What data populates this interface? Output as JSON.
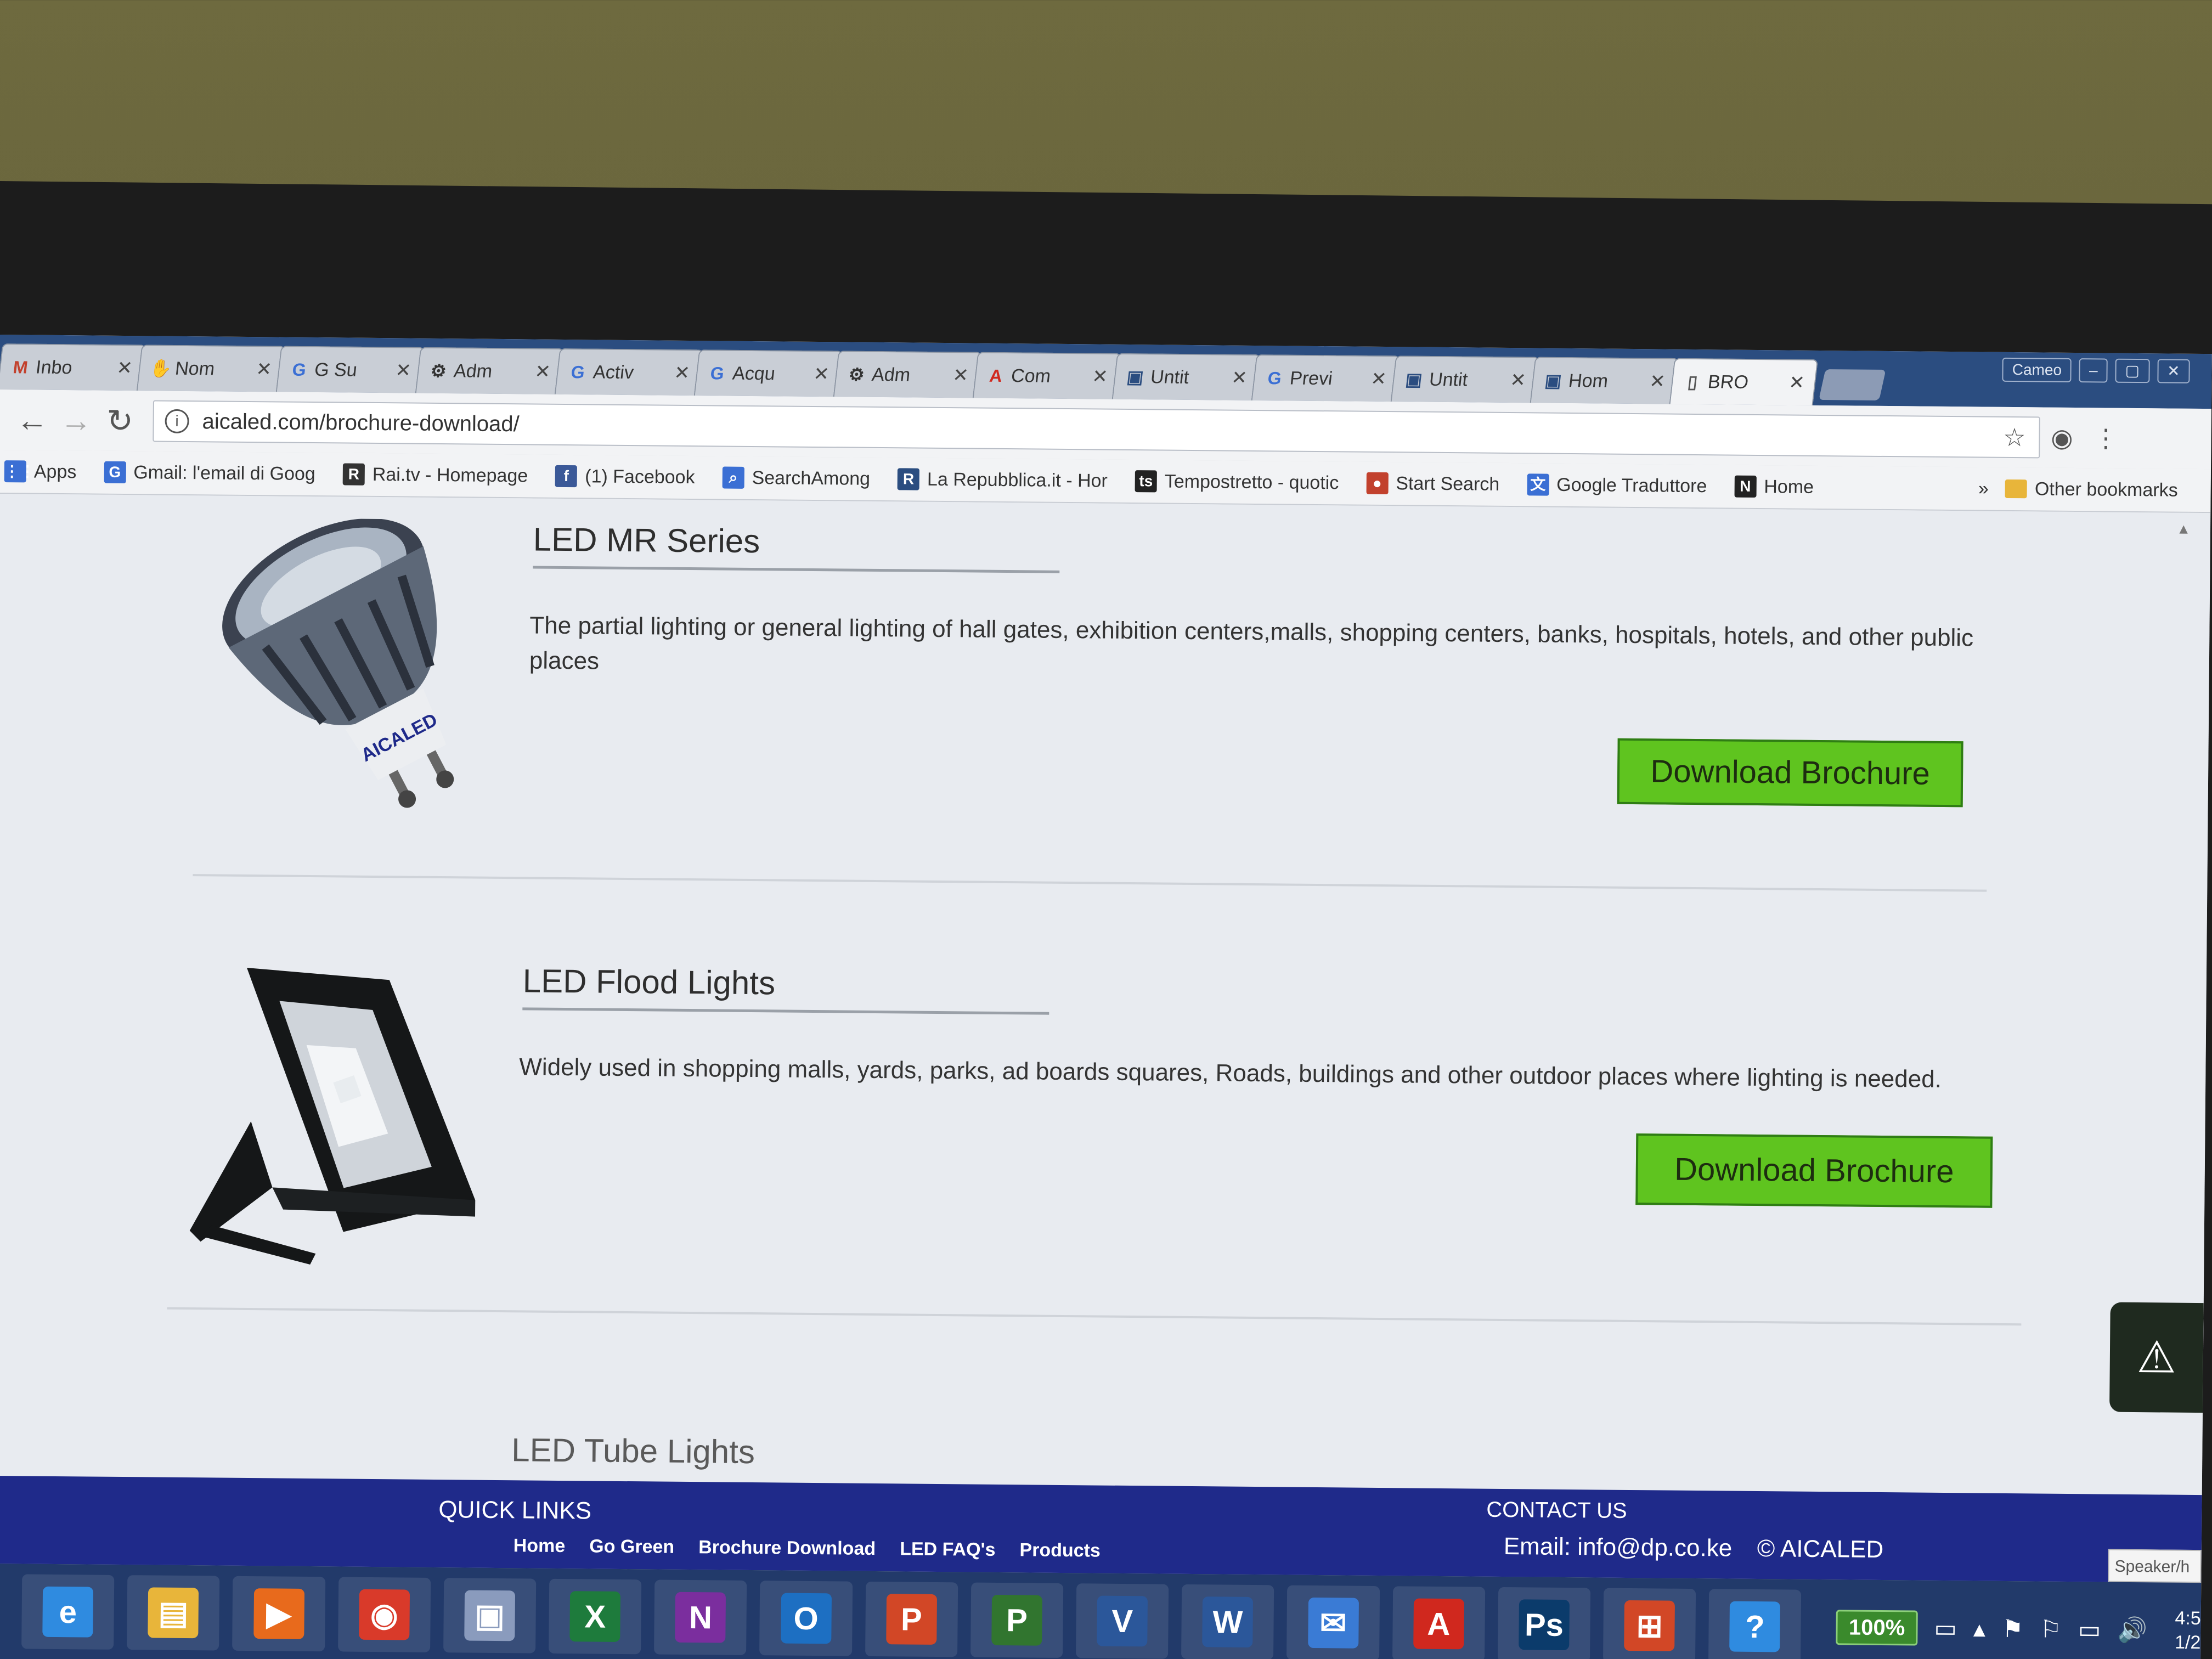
{
  "browser": {
    "tabs": [
      {
        "icon": "gmail-icon",
        "glyph": "M",
        "color": "#c2412d",
        "label": "Inbo"
      },
      {
        "icon": "hand-icon",
        "glyph": "✋",
        "color": "#c28b2d",
        "label": "Nom"
      },
      {
        "icon": "google-icon",
        "glyph": "G",
        "color": "#3b6fd4",
        "label": "G Su"
      },
      {
        "icon": "admin-icon",
        "glyph": "⚙",
        "color": "#333333",
        "label": "Adm"
      },
      {
        "icon": "google-icon",
        "glyph": "G",
        "color": "#3b6fd4",
        "label": "Activ"
      },
      {
        "icon": "google-icon",
        "glyph": "G",
        "color": "#3b6fd4",
        "label": "Acqu"
      },
      {
        "icon": "admin-icon",
        "glyph": "⚙",
        "color": "#333333",
        "label": "Adm"
      },
      {
        "icon": "acrobat-icon",
        "glyph": "A",
        "color": "#d0281e",
        "label": "Com"
      },
      {
        "icon": "page-icon",
        "glyph": "▣",
        "color": "#2b4d80",
        "label": "Untit"
      },
      {
        "icon": "google-icon",
        "glyph": "G",
        "color": "#3b6fd4",
        "label": "Previ"
      },
      {
        "icon": "page-icon",
        "glyph": "▣",
        "color": "#2b4d80",
        "label": "Untit"
      },
      {
        "icon": "page-icon",
        "glyph": "▣",
        "color": "#2b4d80",
        "label": "Hom"
      },
      {
        "icon": "document-icon",
        "glyph": "▯",
        "color": "#555555",
        "label": "BRO",
        "active": true
      }
    ],
    "close_glyph": "✕",
    "window_controls": [
      "Cameo",
      "–",
      "▢",
      "✕"
    ],
    "back_glyph": "←",
    "forward_glyph": "→",
    "reload_glyph": "↻",
    "url": "aicaled.com/brochure-download/",
    "info_glyph": "i",
    "star_glyph": "☆",
    "camera_glyph": "◉",
    "menu_glyph": "⋮",
    "bookmarks": [
      {
        "icon": "apps-icon",
        "glyph": "⋮⋮",
        "color": "#3b6fd4",
        "label": "Apps"
      },
      {
        "icon": "google-icon",
        "glyph": "G",
        "color": "#3b6fd4",
        "label": "Gmail: l'email di Goog"
      },
      {
        "icon": "rai-icon",
        "glyph": "R",
        "color": "#333333",
        "label": "Rai.tv - Homepage"
      },
      {
        "icon": "facebook-icon",
        "glyph": "f",
        "color": "#3b5998",
        "label": "(1) Facebook"
      },
      {
        "icon": "search-icon",
        "glyph": "⌕",
        "color": "#3b6fd4",
        "label": "SearchAmong"
      },
      {
        "icon": "repubblica-icon",
        "glyph": "R",
        "color": "#2b4d80",
        "label": "La Repubblica.it - Hor"
      },
      {
        "icon": "tempostretto-icon",
        "glyph": "ts",
        "color": "#222222",
        "label": "Tempostretto - quotic"
      },
      {
        "icon": "start-search-icon",
        "glyph": "●",
        "color": "#c2412d",
        "label": "Start Search"
      },
      {
        "icon": "translate-icon",
        "glyph": "文",
        "color": "#3b6fd4",
        "label": "Google Traduttore"
      },
      {
        "icon": "home-n-icon",
        "glyph": "N",
        "color": "#222222",
        "label": "Home"
      }
    ],
    "bookmarks_overflow": "»",
    "other_bookmarks": "Other bookmarks"
  },
  "page": {
    "products": [
      {
        "title": "LED MR Series",
        "description": "The partial lighting or general lighting of hall gates, exhibition centers,malls, shopping centers, banks, hospitals, hotels, and other public places",
        "button": "Download Brochure"
      },
      {
        "title": "LED Flood Lights",
        "description": "Widely used in shopping malls, yards, parks, ad boards squares, Roads, buildings and other outdoor places where lighting is needed.",
        "button": "Download Brochure"
      }
    ],
    "lamp_brand": "AICALED",
    "next_section_partial": "LED Tube Lights",
    "scroll_glyph": "▲",
    "accessibility_glyph": "⚠"
  },
  "footer": {
    "quick_links_title": "QUICK LINKS",
    "quick_links": [
      "Home",
      "Go Green",
      "Brochure Download",
      "LED FAQ's",
      "Products"
    ],
    "contact_title": "CONTACT US",
    "email": "Email: info@dp.co.ke",
    "copyright": "© AICALED",
    "speaker_widget": "Speaker/h"
  },
  "taskbar": {
    "apps": [
      {
        "name": "internet-explorer-icon",
        "glyph": "e",
        "color": "#2f8be0"
      },
      {
        "name": "file-explorer-icon",
        "glyph": "▤",
        "color": "#e8b53a"
      },
      {
        "name": "media-player-icon",
        "glyph": "▶",
        "color": "#e86a1c"
      },
      {
        "name": "chrome-icon",
        "glyph": "◉",
        "color": "#d93a2a"
      },
      {
        "name": "app-window-icon",
        "glyph": "▣",
        "color": "#8a9bbd"
      },
      {
        "name": "excel-icon",
        "glyph": "X",
        "color": "#1e7b3c"
      },
      {
        "name": "onenote-icon",
        "glyph": "N",
        "color": "#7b2e9e"
      },
      {
        "name": "outlook-icon",
        "glyph": "O",
        "color": "#1d6fc2"
      },
      {
        "name": "powerpoint-icon",
        "glyph": "P",
        "color": "#d24726"
      },
      {
        "name": "project-icon",
        "glyph": "P",
        "color": "#31752f"
      },
      {
        "name": "visio-icon",
        "glyph": "V",
        "color": "#2b579a"
      },
      {
        "name": "word-icon",
        "glyph": "W",
        "color": "#2b579a"
      },
      {
        "name": "thunderbird-icon",
        "glyph": "✉",
        "color": "#3a7bd5"
      },
      {
        "name": "acrobat-icon",
        "glyph": "A",
        "color": "#d0281e"
      },
      {
        "name": "photoshop-icon",
        "glyph": "Ps",
        "color": "#0b3b6b"
      },
      {
        "name": "office-icon",
        "glyph": "⊞",
        "color": "#d24726"
      },
      {
        "name": "help-icon",
        "glyph": "?",
        "color": "#2f8be0"
      }
    ],
    "battery": "100%",
    "tray_glyphs": [
      "▭",
      "▴",
      "⚑",
      "⚐",
      "▭",
      "🔊"
    ],
    "clock_time": "4:5",
    "clock_date": "1/2"
  }
}
